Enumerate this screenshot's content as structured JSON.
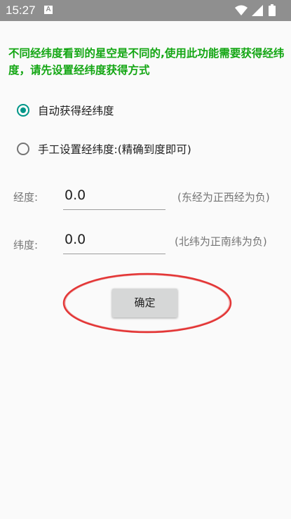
{
  "status_bar": {
    "time": "15:27",
    "notification_letter": "A",
    "icons": [
      "wifi-icon",
      "signal-icon",
      "battery-icon"
    ]
  },
  "hint_text": "不同经纬度看到的星空是不同的,使用此功能需要获得经纬度，请先设置经纬度获得方式",
  "location_mode": {
    "options": [
      {
        "label": "自动获得经纬度",
        "selected": true
      },
      {
        "label": "手工设置经纬度:(精确到度即可)",
        "selected": false
      }
    ]
  },
  "longitude": {
    "label": "经度:",
    "value": "0.0",
    "hint": "(东经为正西经为负)"
  },
  "latitude": {
    "label": "纬度:",
    "value": "0.0",
    "hint": "(北纬为正南纬为负)"
  },
  "confirm_button": {
    "label": "确定"
  },
  "colors": {
    "status_bar": "#8f8f8f",
    "hint_green": "#13a613",
    "radio_accent": "#009688",
    "highlight_red": "#e02020",
    "button_bg": "#d6d7d7"
  }
}
